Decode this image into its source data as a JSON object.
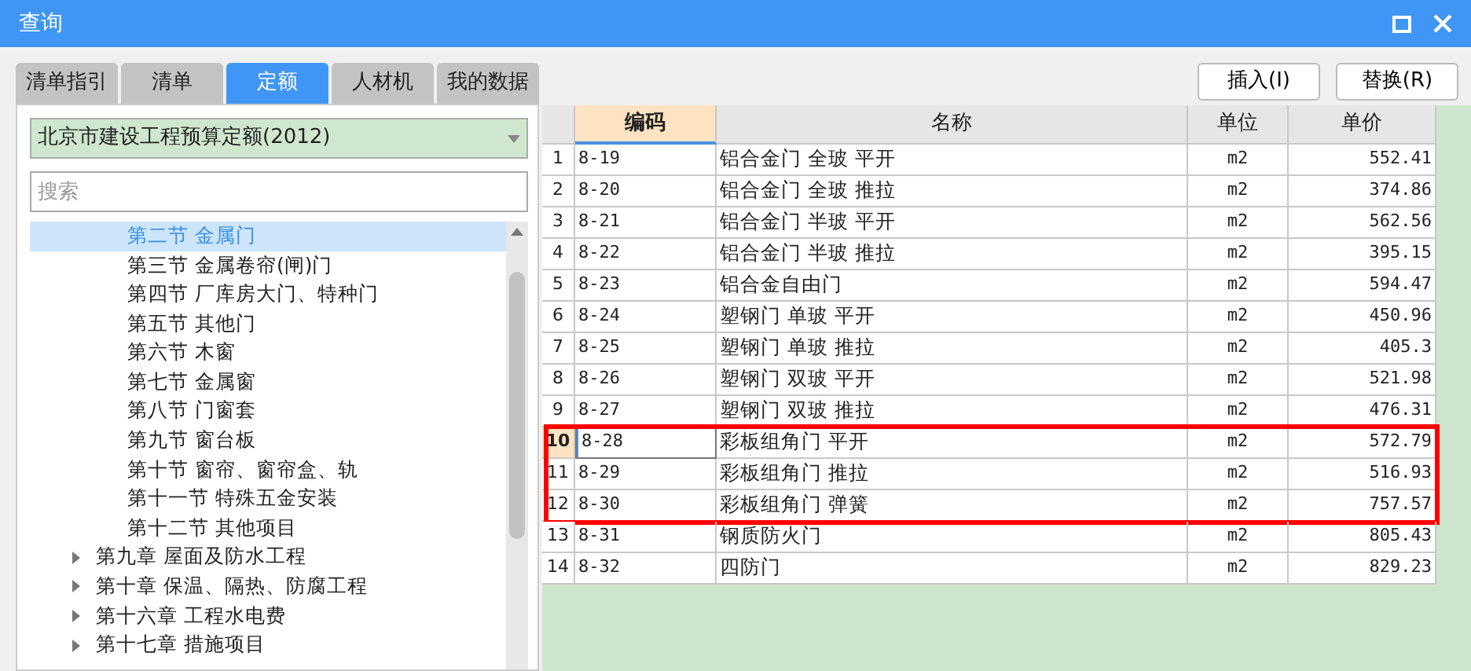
{
  "window": {
    "title": "查询"
  },
  "tabs": [
    {
      "label": "清单指引",
      "selected": false
    },
    {
      "label": "清单",
      "selected": false
    },
    {
      "label": "定额",
      "selected": true
    },
    {
      "label": "人材机",
      "selected": false
    },
    {
      "label": "我的数据",
      "selected": false
    }
  ],
  "buttons": [
    "插入(I)",
    "替换(R)"
  ],
  "library_select": {
    "value": "北京市建设工程预算定额(2012)"
  },
  "search": {
    "placeholder": "搜索"
  },
  "tree": [
    {
      "label": "第二节 金属门",
      "selected": true
    },
    {
      "label": "第三节 金属卷帘(闸)门",
      "selected": false
    },
    {
      "label": "第四节 厂库房大门、特种门",
      "selected": false
    },
    {
      "label": "第五节 其他门",
      "selected": false
    },
    {
      "label": "第六节 木窗",
      "selected": false
    },
    {
      "label": "第七节 金属窗",
      "selected": false
    },
    {
      "label": "第八节 门窗套",
      "selected": false
    },
    {
      "label": "第九节 窗台板",
      "selected": false
    },
    {
      "label": "第十节 窗帘、窗帘盒、轨",
      "selected": false
    },
    {
      "label": "第十一节 特殊五金安装",
      "selected": false
    },
    {
      "label": "第十二节 其他项目",
      "selected": false
    },
    {
      "label": "第九章 屋面及防水工程",
      "selected": false,
      "expanded": false
    },
    {
      "label": "第十章 保温、隔热、防腐工程",
      "selected": false,
      "expanded": false
    },
    {
      "label": "第十六章 工程水电费",
      "selected": false,
      "expanded": false
    },
    {
      "label": "第十七章 措施项目",
      "selected": false,
      "expanded": false
    }
  ],
  "table": {
    "columns": [
      "编码",
      "名称",
      "单位",
      "单价"
    ],
    "rows": [
      {
        "num": "1",
        "code": "8-19",
        "name": "铝合金门 全玻 平开",
        "unit": "m2",
        "price": "552.41",
        "selected": false,
        "highlighted": false
      },
      {
        "num": "2",
        "code": "8-20",
        "name": "铝合金门 全玻 推拉",
        "unit": "m2",
        "price": "374.86",
        "selected": false,
        "highlighted": false
      },
      {
        "num": "3",
        "code": "8-21",
        "name": "铝合金门 半玻 平开",
        "unit": "m2",
        "price": "562.56",
        "selected": false,
        "highlighted": false
      },
      {
        "num": "4",
        "code": "8-22",
        "name": "铝合金门 半玻 推拉",
        "unit": "m2",
        "price": "395.15",
        "selected": false,
        "highlighted": false
      },
      {
        "num": "5",
        "code": "8-23",
        "name": "铝合金自由门",
        "unit": "m2",
        "price": "594.47",
        "selected": false,
        "highlighted": false
      },
      {
        "num": "6",
        "code": "8-24",
        "name": "塑钢门 单玻 平开",
        "unit": "m2",
        "price": "450.96",
        "selected": false,
        "highlighted": false
      },
      {
        "num": "7",
        "code": "8-25",
        "name": "塑钢门 单玻 推拉",
        "unit": "m2",
        "price": "405.3",
        "selected": false,
        "highlighted": false
      },
      {
        "num": "8",
        "code": "8-26",
        "name": "塑钢门 双玻 平开",
        "unit": "m2",
        "price": "521.98",
        "selected": false,
        "highlighted": false
      },
      {
        "num": "9",
        "code": "8-27",
        "name": "塑钢门 双玻 推拉",
        "unit": "m2",
        "price": "476.31",
        "selected": false,
        "highlighted": false
      },
      {
        "num": "10",
        "code": "8-28",
        "name": "彩板组角门 平开",
        "unit": "m2",
        "price": "572.79",
        "selected": true,
        "highlighted": true
      },
      {
        "num": "11",
        "code": "8-29",
        "name": "彩板组角门 推拉",
        "unit": "m2",
        "price": "516.93",
        "selected": false,
        "highlighted": true
      },
      {
        "num": "12",
        "code": "8-30",
        "name": "彩板组角门 弹簧",
        "unit": "m2",
        "price": "757.57",
        "selected": false,
        "highlighted": true
      },
      {
        "num": "13",
        "code": "8-31",
        "name": "钢质防火门",
        "unit": "m2",
        "price": "805.43",
        "selected": false,
        "highlighted": false
      },
      {
        "num": "14",
        "code": "8-32",
        "name": "四防门",
        "unit": "m2",
        "price": "829.23",
        "selected": false,
        "highlighted": false
      }
    ]
  }
}
